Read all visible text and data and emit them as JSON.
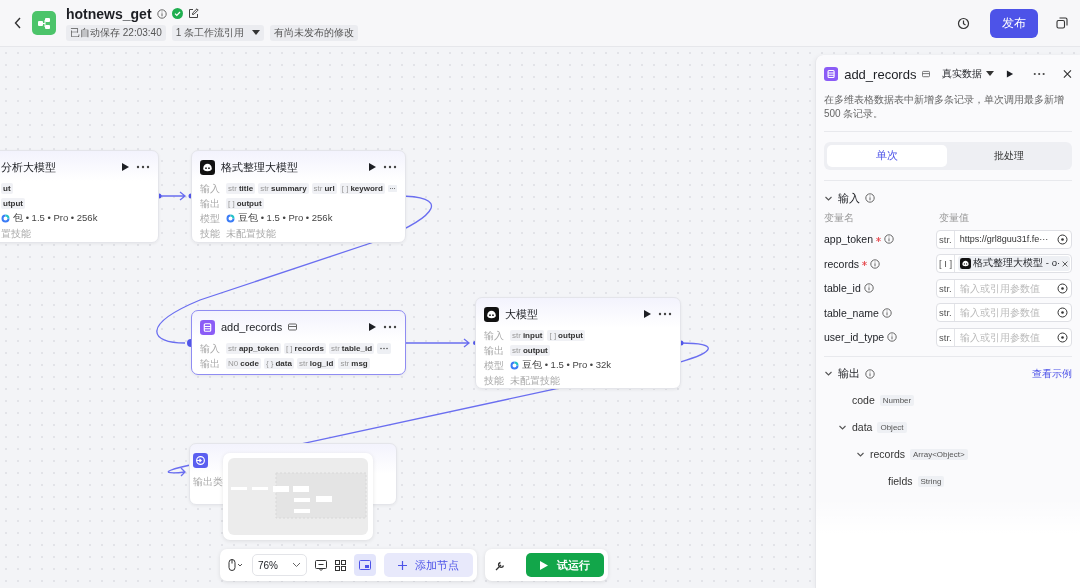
{
  "header": {
    "title": "hotnews_get",
    "saved": "已自动保存 22:03:40",
    "references": "1 条工作流引用",
    "unpublished": "有尚未发布的修改",
    "publish": "发布"
  },
  "nodes": [
    {
      "title": "分析大模型",
      "selected": false,
      "rows": [
        {
          "tags": [
            {
              "name": "ut"
            }
          ]
        },
        {
          "tags": [
            {
              "name": "utput"
            }
          ]
        },
        {
          "model": "包 • 1.5 • Pro • 256k"
        },
        {
          "text": "置技能"
        }
      ]
    },
    {
      "kind": "llm",
      "title": "格式整理大模型",
      "selected": false,
      "rows": [
        {
          "label": "输入",
          "tags": [
            {
              "type": "str",
              "name": "title"
            },
            {
              "type": "str",
              "name": "summary"
            },
            {
              "type": "str",
              "name": "url"
            },
            {
              "type": "[ ]",
              "name": "keyword"
            }
          ],
          "more": true
        },
        {
          "label": "输出",
          "tags": [
            {
              "type": "[ ]",
              "name": "output"
            }
          ]
        },
        {
          "label": "模型",
          "model": "豆包 • 1.5 • Pro • 256k"
        },
        {
          "label": "技能",
          "text": "未配置技能"
        }
      ]
    },
    {
      "kind": "plugin",
      "title": "add_records",
      "selected": true,
      "rows": [
        {
          "label": "输入",
          "tags": [
            {
              "type": "str",
              "name": "app_token"
            },
            {
              "type": "[ ]",
              "name": "records"
            },
            {
              "type": "str",
              "name": "table_id"
            }
          ],
          "more": true
        },
        {
          "label": "输出",
          "tags": [
            {
              "type": "N0",
              "name": "code"
            },
            {
              "type": "{ }",
              "name": "data"
            },
            {
              "type": "str",
              "name": "log_id"
            },
            {
              "type": "str",
              "name": "msg"
            }
          ]
        }
      ]
    },
    {
      "kind": "llm",
      "title": "大模型",
      "selected": false,
      "rows": [
        {
          "label": "输入",
          "tags": [
            {
              "type": "str",
              "name": "input"
            },
            {
              "type": "[ ]",
              "name": "output"
            }
          ]
        },
        {
          "label": "输出",
          "tags": [
            {
              "type": "str",
              "name": "output"
            }
          ]
        },
        {
          "label": "模型",
          "model": "豆包 • 1.5 • Pro • 32k"
        },
        {
          "label": "技能",
          "text": "未配置技能"
        }
      ]
    },
    {
      "kind": "end",
      "selected": false,
      "rows": [
        {
          "label": "输出类"
        }
      ]
    }
  ],
  "panel": {
    "title": "add_records",
    "data_mode": "真实数据",
    "description": "在多维表格数据表中新增多条记录，单次调用最多新增 500 条记录。",
    "tabs": [
      {
        "label": "单次",
        "selected": true
      },
      {
        "label": "批处理",
        "selected": false
      }
    ],
    "input_title": "输入",
    "headers": [
      "变量名",
      "变量值"
    ],
    "params": [
      {
        "name": "app_token",
        "required": true,
        "type": "str.",
        "value": "https://grl8guu31f.fe···"
      },
      {
        "name": "records",
        "required": true,
        "type": "[ I ]",
        "ref": "格式整理大模型 - o·"
      },
      {
        "name": "table_id",
        "required": false,
        "type": "str.",
        "placeholder": "输入或引用参数值"
      },
      {
        "name": "table_name",
        "required": false,
        "type": "str.",
        "placeholder": "输入或引用参数值"
      },
      {
        "name": "user_id_type",
        "required": false,
        "type": "str.",
        "placeholder": "输入或引用参数值"
      }
    ],
    "output_title": "输出",
    "example_link": "查看示例",
    "outputs": [
      {
        "name": "code",
        "type": "Number"
      },
      {
        "name": "data",
        "type": "Object",
        "expanded": true,
        "children": [
          {
            "name": "records",
            "type": "Array<Object>",
            "expanded": true,
            "children": [
              {
                "name": "fields",
                "type": "String"
              }
            ]
          }
        ]
      }
    ]
  },
  "toolbar": {
    "zoom": "76%",
    "minimap_on": true,
    "add_node": "添加节点",
    "run": "试运行"
  }
}
